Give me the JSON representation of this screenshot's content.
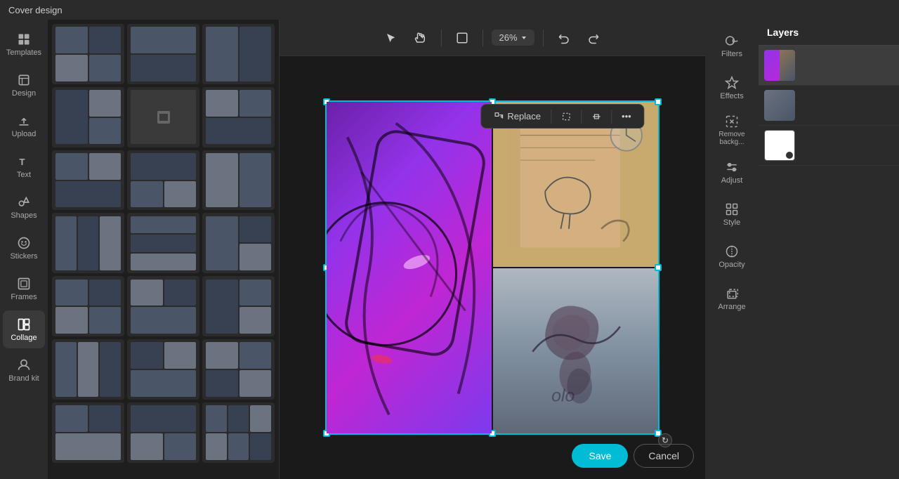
{
  "app": {
    "title": "Cover design"
  },
  "sidebar": {
    "items": [
      {
        "id": "templates",
        "label": "Templates",
        "icon": "templates"
      },
      {
        "id": "design",
        "label": "Design",
        "icon": "design"
      },
      {
        "id": "upload",
        "label": "Upload",
        "icon": "upload"
      },
      {
        "id": "text",
        "label": "Text",
        "icon": "text"
      },
      {
        "id": "shapes",
        "label": "Shapes",
        "icon": "shapes"
      },
      {
        "id": "stickers",
        "label": "Stickers",
        "icon": "stickers"
      },
      {
        "id": "frames",
        "label": "Frames",
        "icon": "frames"
      },
      {
        "id": "collage",
        "label": "Collage",
        "icon": "collage",
        "active": true
      },
      {
        "id": "brand",
        "label": "Brand kit",
        "icon": "brand"
      }
    ]
  },
  "toolbar": {
    "zoom": "26%",
    "undo_label": "↩",
    "redo_label": "↪"
  },
  "floating_toolbar": {
    "replace_label": "Replace",
    "more_label": "..."
  },
  "right_tools": [
    {
      "id": "filters",
      "label": "Filters",
      "icon": "filters"
    },
    {
      "id": "effects",
      "label": "Effects",
      "icon": "effects"
    },
    {
      "id": "remove-bg",
      "label": "Remove backg...",
      "icon": "remove-bg"
    },
    {
      "id": "adjust",
      "label": "Adjust",
      "icon": "adjust"
    },
    {
      "id": "style",
      "label": "Style",
      "icon": "style"
    },
    {
      "id": "opacity",
      "label": "Opacity",
      "icon": "opacity"
    },
    {
      "id": "arrange",
      "label": "Arrange",
      "icon": "arrange"
    }
  ],
  "layers": {
    "title": "Layers",
    "items": [
      {
        "id": 1,
        "type": "collage",
        "active": true
      },
      {
        "id": 2,
        "type": "photo"
      },
      {
        "id": 3,
        "type": "white"
      }
    ]
  },
  "buttons": {
    "save": "Save",
    "cancel": "Cancel"
  }
}
